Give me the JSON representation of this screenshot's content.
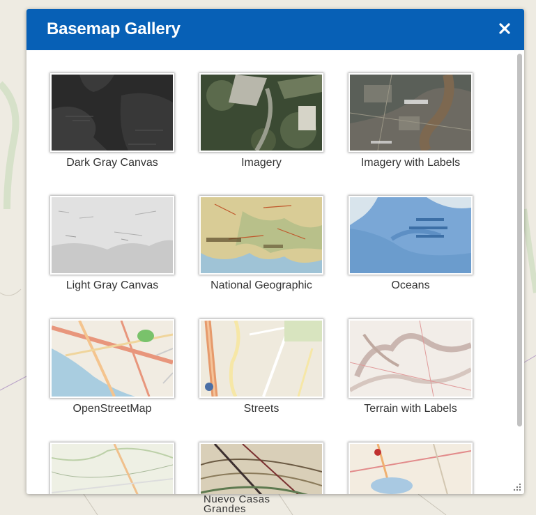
{
  "panel": {
    "title": "Basemap Gallery",
    "close_icon": "close-icon"
  },
  "basemaps": [
    {
      "label": "Dark Gray Canvas"
    },
    {
      "label": "Imagery"
    },
    {
      "label": "Imagery with Labels"
    },
    {
      "label": "Light Gray Canvas"
    },
    {
      "label": "National Geographic"
    },
    {
      "label": "Oceans"
    },
    {
      "label": "OpenStreetMap"
    },
    {
      "label": "Streets"
    },
    {
      "label": "Terrain with Labels"
    },
    {
      "label": ""
    },
    {
      "label": ""
    },
    {
      "label": ""
    }
  ],
  "map": {
    "place_label": "Nuevo Casas Grandes"
  },
  "colors": {
    "header_bg": "#0760b6",
    "header_text": "#ffffff",
    "label_text": "#333333",
    "scrollbar": "#c1c1c1"
  }
}
